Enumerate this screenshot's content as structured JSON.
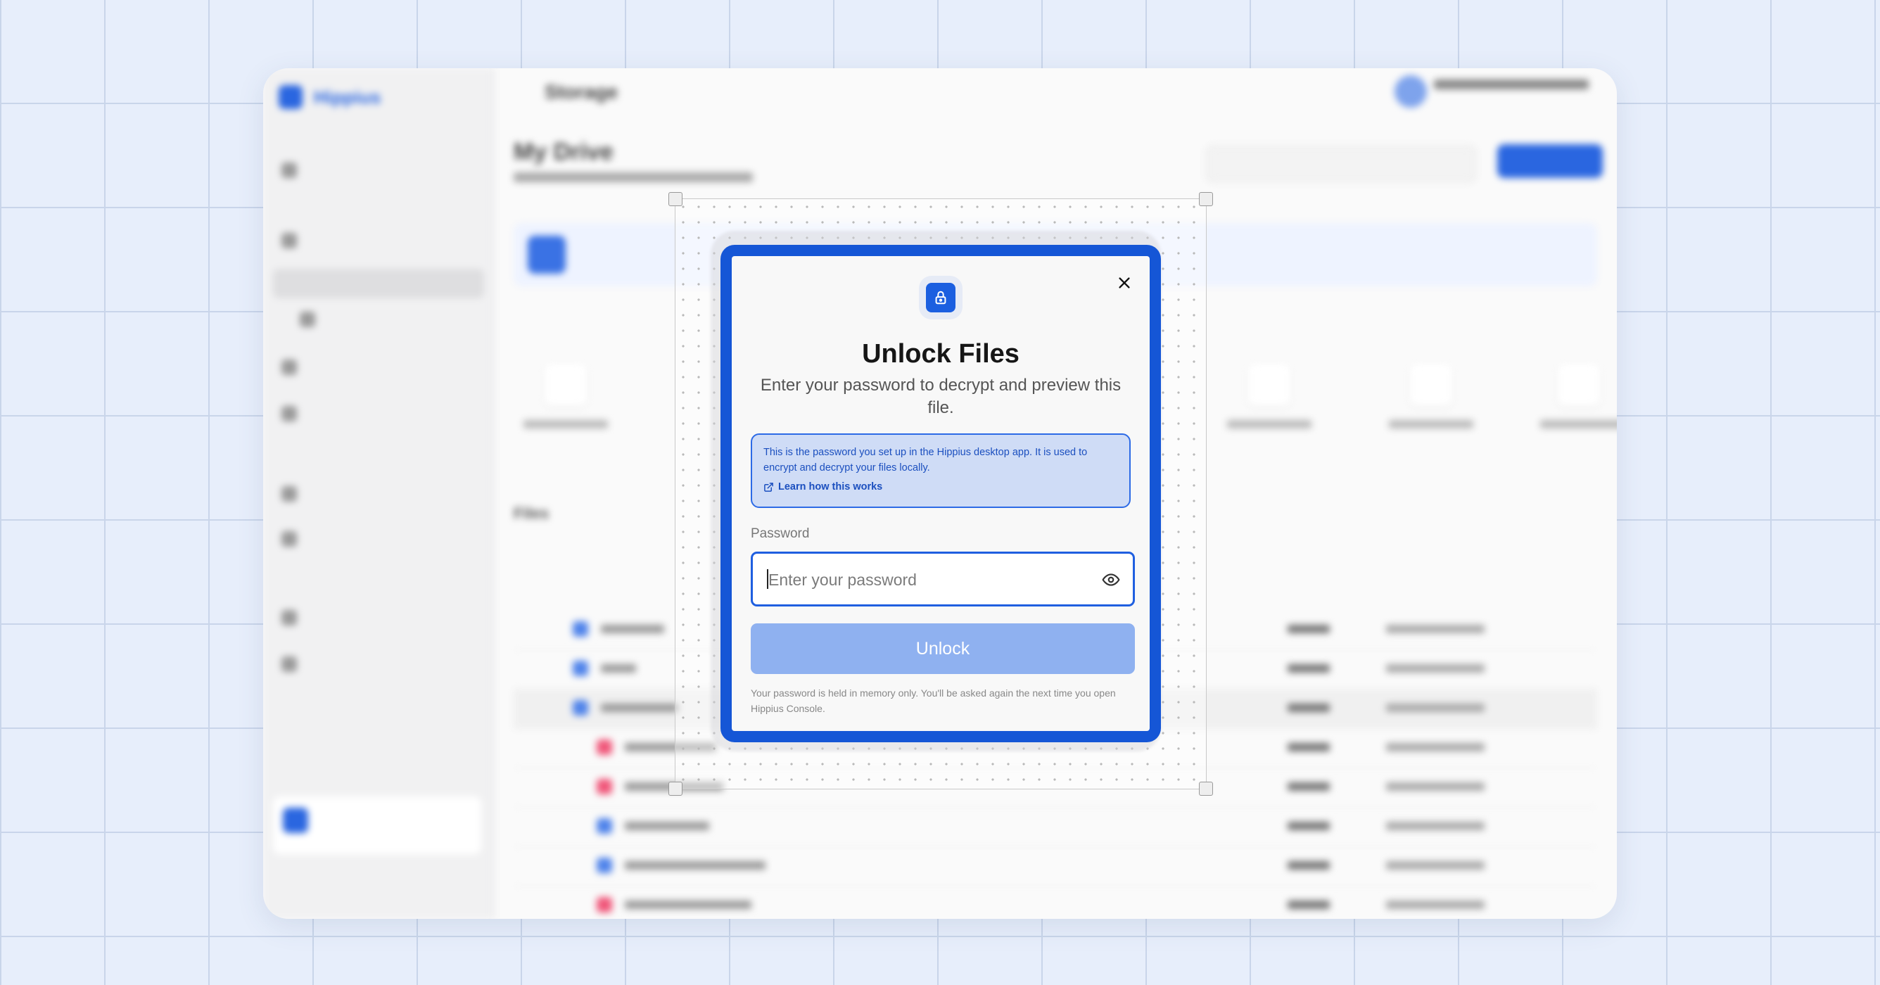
{
  "modal": {
    "title": "Unlock Files",
    "subtitle": "Enter your password to decrypt and preview this file.",
    "info_text": "This is the password you set up in the Hippius desktop app. It is used to encrypt and decrypt your files locally.",
    "info_link": "Learn how this works",
    "password_label": "Password",
    "password_placeholder": "Enter your password",
    "password_value": "",
    "unlock_label": "Unlock",
    "footer_note": "Your password is held in memory only. You'll be asked again the next time you open Hippius Console.",
    "icons": {
      "lock": "lock-icon",
      "close": "close-icon",
      "external_link": "external-link-icon",
      "show_password": "eye-icon"
    }
  },
  "background_app": {
    "brand": "Hippius",
    "page_title": "Storage",
    "section_title": "My Drive",
    "files_heading": "Files",
    "colors": {
      "accent": "#1b5fe0",
      "unlock_disabled": "#8fb1f0",
      "info_bg": "#cfdcf6"
    }
  }
}
